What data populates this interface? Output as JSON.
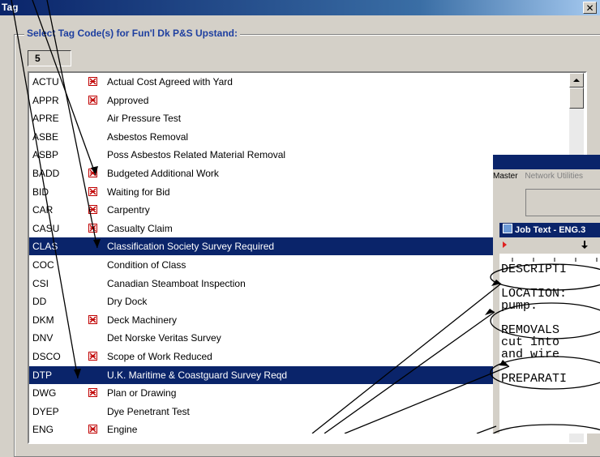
{
  "dialog": {
    "title": "Tag",
    "close_label": "✕",
    "group_label": "Select Tag Code(s) for Fun'l Dk P&S Upstand:",
    "count_value": "5"
  },
  "tags": [
    {
      "code": "ACTU",
      "desc": "Actual Cost Agreed with Yard",
      "icon": true,
      "selected": false
    },
    {
      "code": "APPR",
      "desc": "Approved",
      "icon": true,
      "selected": false
    },
    {
      "code": "APRE",
      "desc": "Air Pressure Test",
      "icon": false,
      "selected": false
    },
    {
      "code": "ASBE",
      "desc": "Asbestos Removal",
      "icon": false,
      "selected": false
    },
    {
      "code": "ASBP",
      "desc": "Poss Asbestos Related Material Removal",
      "icon": false,
      "selected": false
    },
    {
      "code": "BADD",
      "desc": "Budgeted Additional Work",
      "icon": true,
      "selected": false
    },
    {
      "code": "BID",
      "desc": "Waiting for Bid",
      "icon": true,
      "selected": false
    },
    {
      "code": "CAR",
      "desc": "Carpentry",
      "icon": true,
      "selected": false
    },
    {
      "code": "CASU",
      "desc": "Casualty Claim",
      "icon": true,
      "selected": false
    },
    {
      "code": "CLAS",
      "desc": "Classification Society Survey Required",
      "icon": false,
      "selected": true
    },
    {
      "code": "COC",
      "desc": "Condition of Class",
      "icon": false,
      "selected": false
    },
    {
      "code": "CSI",
      "desc": "Canadian Steamboat Inspection",
      "icon": false,
      "selected": false
    },
    {
      "code": "DD",
      "desc": "Dry Dock",
      "icon": false,
      "selected": false
    },
    {
      "code": "DKM",
      "desc": "Deck Machinery",
      "icon": true,
      "selected": false
    },
    {
      "code": "DNV",
      "desc": "Det Norske Veritas Survey",
      "icon": false,
      "selected": false
    },
    {
      "code": "DSCO",
      "desc": "Scope of Work Reduced",
      "icon": true,
      "selected": false
    },
    {
      "code": "DTP",
      "desc": "U.K. Maritime & Coastguard Survey Reqd",
      "icon": false,
      "selected": true
    },
    {
      "code": "DWG",
      "desc": "Plan or Drawing",
      "icon": true,
      "selected": false
    },
    {
      "code": "DYEP",
      "desc": "Dye Penetrant Test",
      "icon": false,
      "selected": false
    },
    {
      "code": "ENG",
      "desc": "Engine",
      "icon": true,
      "selected": false
    }
  ],
  "background_window": {
    "menu_master": "Master",
    "menu_network": "Network Utilities",
    "job_text_title": "Job Text - ENG.3",
    "lines": [
      "DESCRIPTI",
      "LOCATION:",
      "pump.",
      "",
      "REMOVALS",
      "cut into",
      "and wire",
      "",
      "PREPARATI"
    ]
  }
}
